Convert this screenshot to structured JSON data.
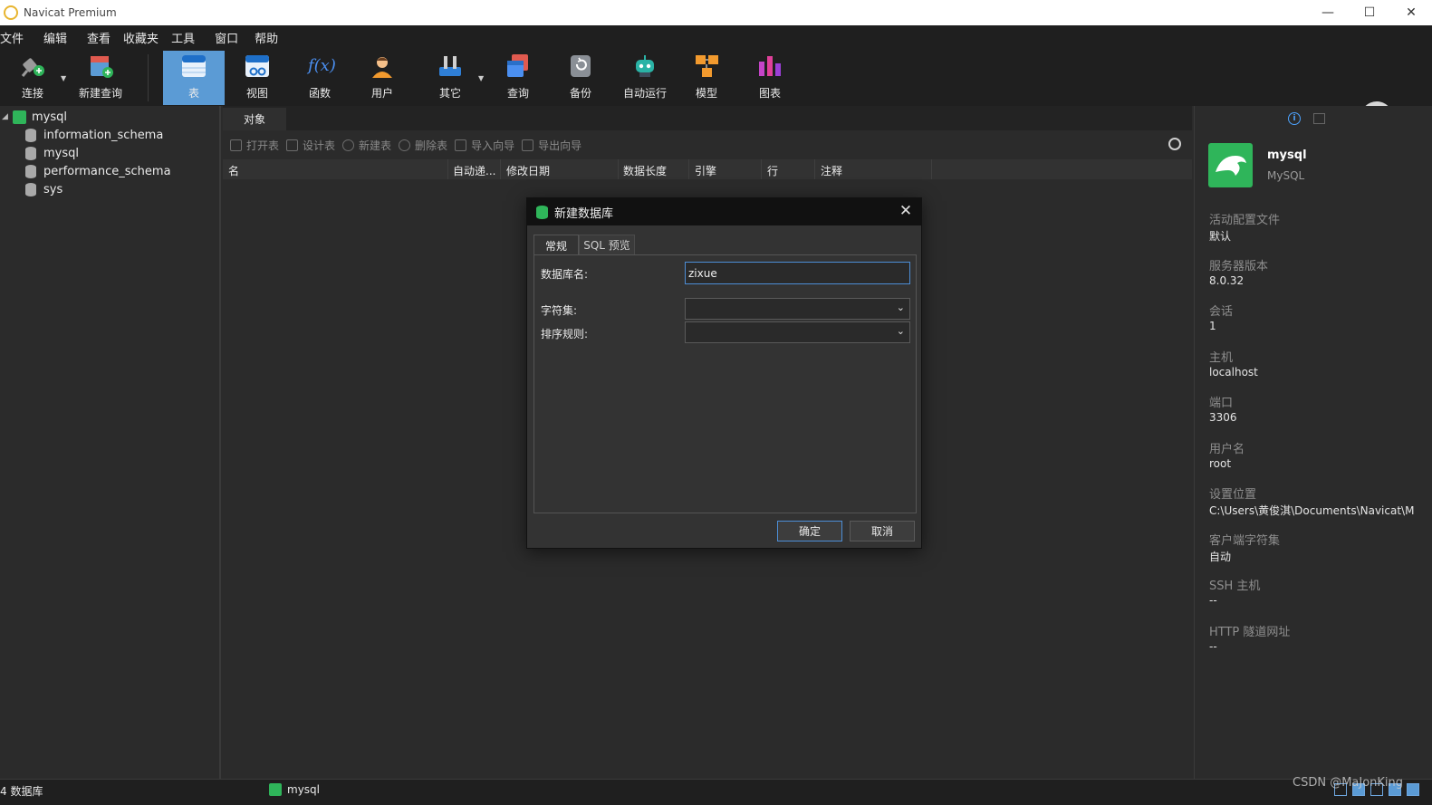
{
  "window": {
    "title": "Navicat Premium",
    "controls": [
      "—",
      "☐",
      "✕"
    ]
  },
  "menu": [
    "文件",
    "编辑",
    "查看",
    "收藏夹",
    "工具",
    "窗口",
    "帮助"
  ],
  "toolbar": {
    "connect": "连接",
    "new_query": "新建查询",
    "table": "表",
    "view": "视图",
    "function": "函数",
    "function_glyph": "f(x)",
    "user": "用户",
    "other": "其它",
    "query": "查询",
    "backup": "备份",
    "automation": "自动运行",
    "model": "模型",
    "chart": "图表"
  },
  "tree": {
    "connection": "mysql",
    "databases": [
      "information_schema",
      "mysql",
      "performance_schema",
      "sys"
    ]
  },
  "center": {
    "tab": "对象",
    "actions": [
      "打开表",
      "设计表",
      "新建表",
      "删除表",
      "导入向导",
      "导出向导"
    ],
    "columns": [
      "名",
      "自动递...",
      "修改日期",
      "数据长度",
      "引擎",
      "行",
      "注释"
    ]
  },
  "dialog": {
    "title": "新建数据库",
    "close": "✕",
    "tabs": [
      "常规",
      "SQL 预览"
    ],
    "db_name_label": "数据库名:",
    "db_name_value": "zixue",
    "charset_label": "字符集:",
    "charset_value": "",
    "collation_label": "排序规则:",
    "collation_value": "",
    "ok": "确定",
    "cancel": "取消"
  },
  "info_panel": {
    "name": "mysql",
    "type": "MySQL",
    "props": [
      {
        "key": "活动配置文件",
        "value": "默认"
      },
      {
        "key": "服务器版本",
        "value": "8.0.32"
      },
      {
        "key": "会话",
        "value": "1"
      },
      {
        "key": "主机",
        "value": "localhost"
      },
      {
        "key": "端口",
        "value": "3306"
      },
      {
        "key": "用户名",
        "value": "root"
      },
      {
        "key": "设置位置",
        "value": "C:\\Users\\黄俊淇\\Documents\\Navicat\\M"
      },
      {
        "key": "客户端字符集",
        "value": "自动"
      },
      {
        "key": "SSH 主机",
        "value": "--"
      },
      {
        "key": "HTTP 隧道网址",
        "value": "--"
      }
    ]
  },
  "status": {
    "db_count": "4 数据库",
    "connection": "mysql",
    "watermark": "CSDN @MaJonKing"
  },
  "colors": {
    "accent": "#5b9bd5",
    "connection_green": "#2fb55a",
    "background": "#2b2b2b"
  }
}
